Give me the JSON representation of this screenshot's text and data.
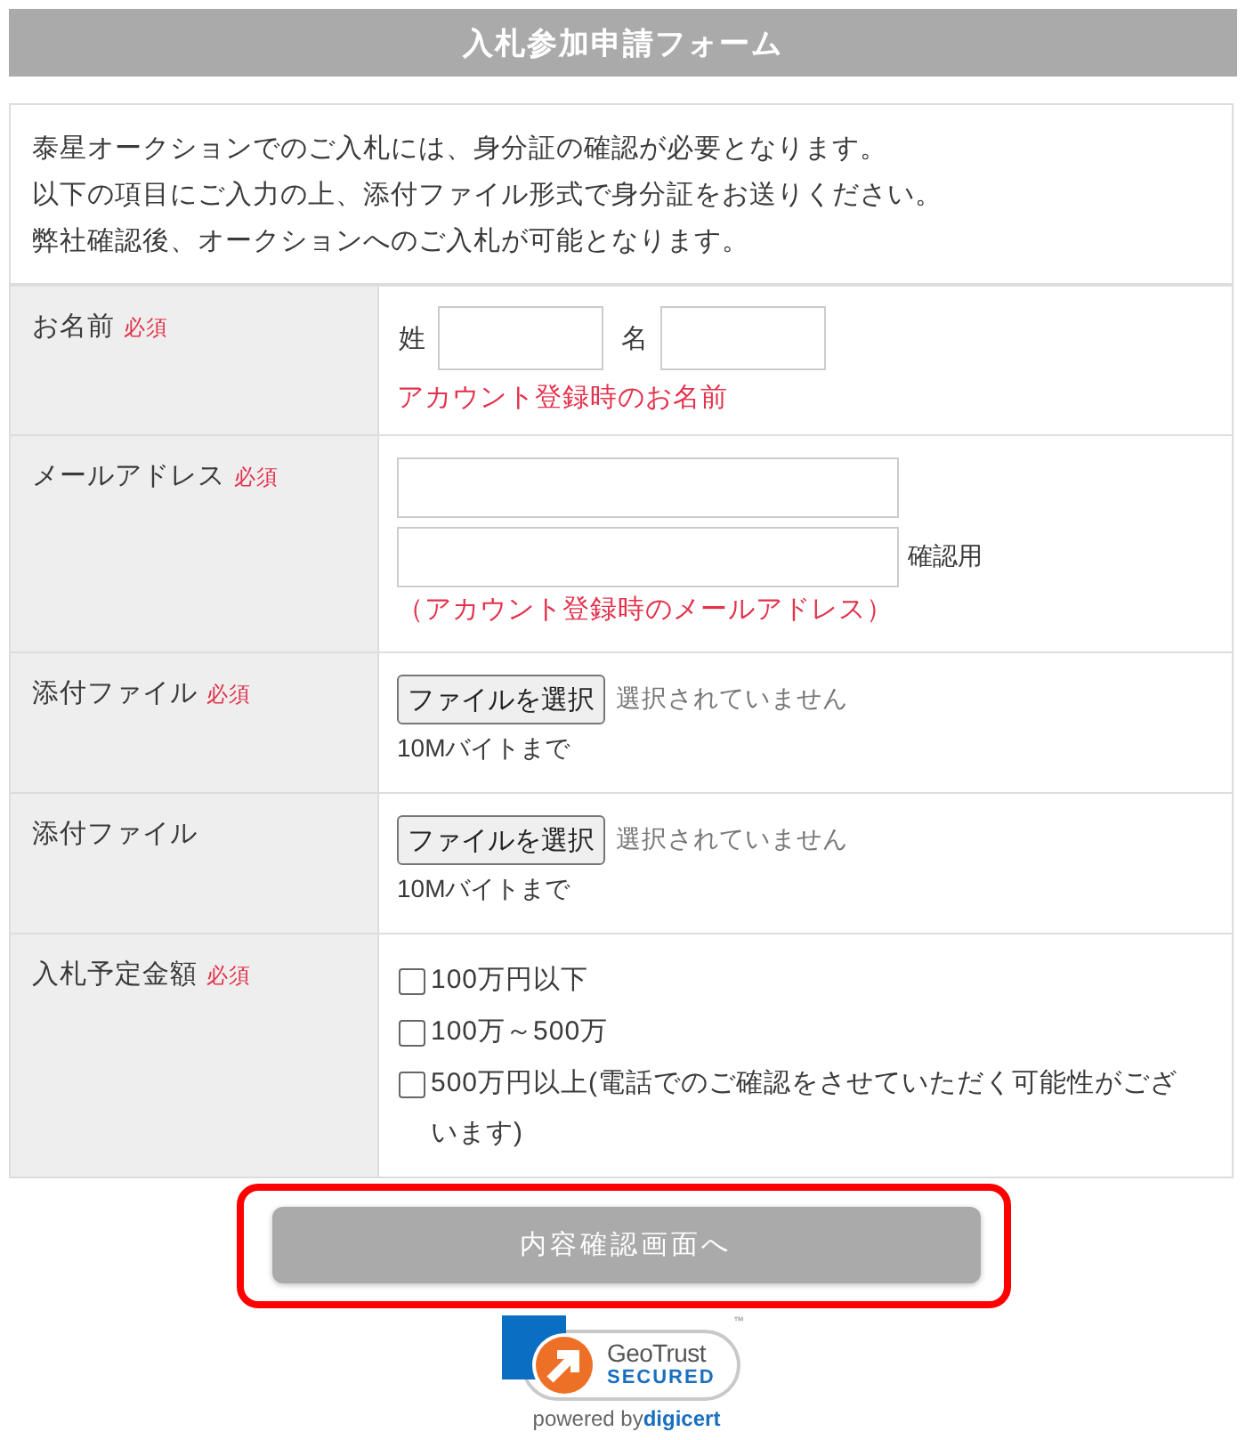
{
  "header": {
    "title": "入札参加申請フォーム"
  },
  "intro": [
    "泰星オークションでのご入札には、身分証の確認が必要となります。",
    "以下の項目にご入力の上、添付ファイル形式で身分証をお送りください。",
    "弊社確認後、オークションへのご入札が可能となります。"
  ],
  "form_rows": [
    {
      "kind": "name",
      "label": "お名前",
      "required_mark": "必須",
      "fields": [
        {
          "label": "姓"
        },
        {
          "label": "名"
        }
      ],
      "note": "アカウント登録時のお名前"
    },
    {
      "kind": "email",
      "label": "メールアドレス",
      "required_mark": "必須",
      "confirm_label": "確認用",
      "note": "（アカウント登録時のメールアドレス）"
    },
    {
      "kind": "file",
      "label": "添付ファイル",
      "required_mark": "必須",
      "button": "ファイルを選択",
      "status": "選択されていません",
      "note": "10Mバイトまで"
    },
    {
      "kind": "file",
      "label": "添付ファイル",
      "button": "ファイルを選択",
      "status": "選択されていません",
      "note": "10Mバイトまで"
    },
    {
      "kind": "checkboxes",
      "label": "入札予定金額",
      "required_mark": "必須",
      "options": [
        {
          "label": "100万円以下",
          "checked": false
        },
        {
          "label": "100万～500万",
          "checked": false
        },
        {
          "label": "500万円以上(電話でのご確認をさせていただく可能性がございます)",
          "checked": false
        }
      ]
    }
  ],
  "submit": {
    "label": "内容確認画面へ",
    "highlighted": true
  },
  "seal": {
    "brand": "GeoTrust",
    "status": "SECURED",
    "trademark": "™",
    "powered_by": "powered by",
    "vendor": "digicert"
  }
}
